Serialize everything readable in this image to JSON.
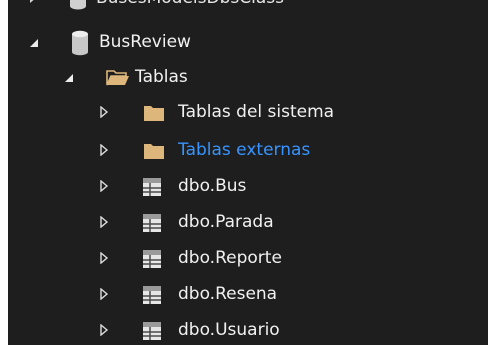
{
  "tree": {
    "partial_node": {
      "label": "BusesModelsDbsClass"
    },
    "database": {
      "label": "BusReview",
      "icon": "database-icon",
      "expanded": true
    },
    "tables_folder": {
      "label": "Tablas",
      "icon": "folder-open-icon",
      "expanded": true
    },
    "children": [
      {
        "label": "Tablas del sistema",
        "icon": "folder-icon",
        "kind": "folder"
      },
      {
        "label": "Tablas externas",
        "icon": "folder-icon",
        "kind": "folder",
        "highlighted": true
      },
      {
        "label": "dbo.Bus",
        "icon": "table-icon",
        "kind": "table"
      },
      {
        "label": "dbo.Parada",
        "icon": "table-icon",
        "kind": "table"
      },
      {
        "label": "dbo.Reporte",
        "icon": "table-icon",
        "kind": "table"
      },
      {
        "label": "dbo.Resena",
        "icon": "table-icon",
        "kind": "table"
      },
      {
        "label": "dbo.Usuario",
        "icon": "table-icon",
        "kind": "table"
      }
    ]
  },
  "colors": {
    "background": "#1e1e1e",
    "text": "#f1f1f1",
    "link_text": "#3794ff",
    "folder": "#dcb67a"
  }
}
